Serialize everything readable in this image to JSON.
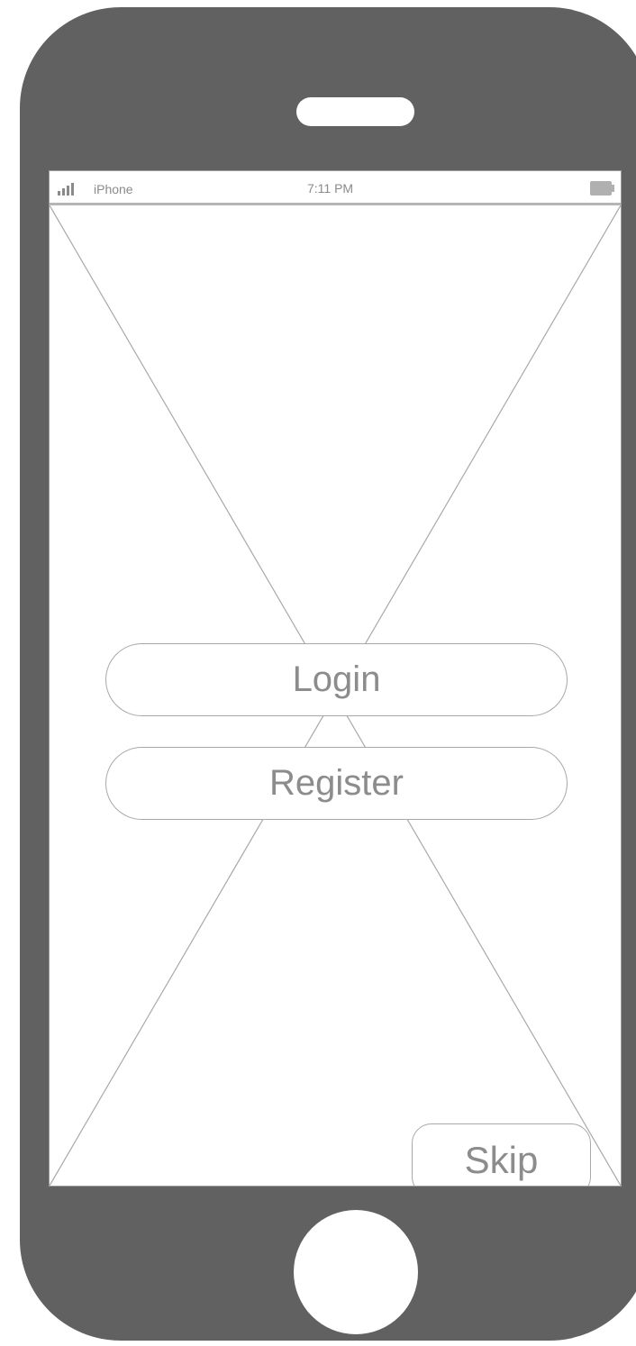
{
  "status_bar": {
    "carrier": "iPhone",
    "time": "7:11 PM",
    "signal_icon": "signal-bars-icon",
    "battery_icon": "battery-icon"
  },
  "placeholder": {
    "icon": "image-placeholder-icon"
  },
  "actions": {
    "login_label": "Login",
    "register_label": "Register",
    "skip_label": "Skip"
  },
  "device": {
    "frame_color": "#616161",
    "screen_color": "#ffffff",
    "outline_color": "#a8a8a8",
    "text_color": "#8c8c8c"
  }
}
